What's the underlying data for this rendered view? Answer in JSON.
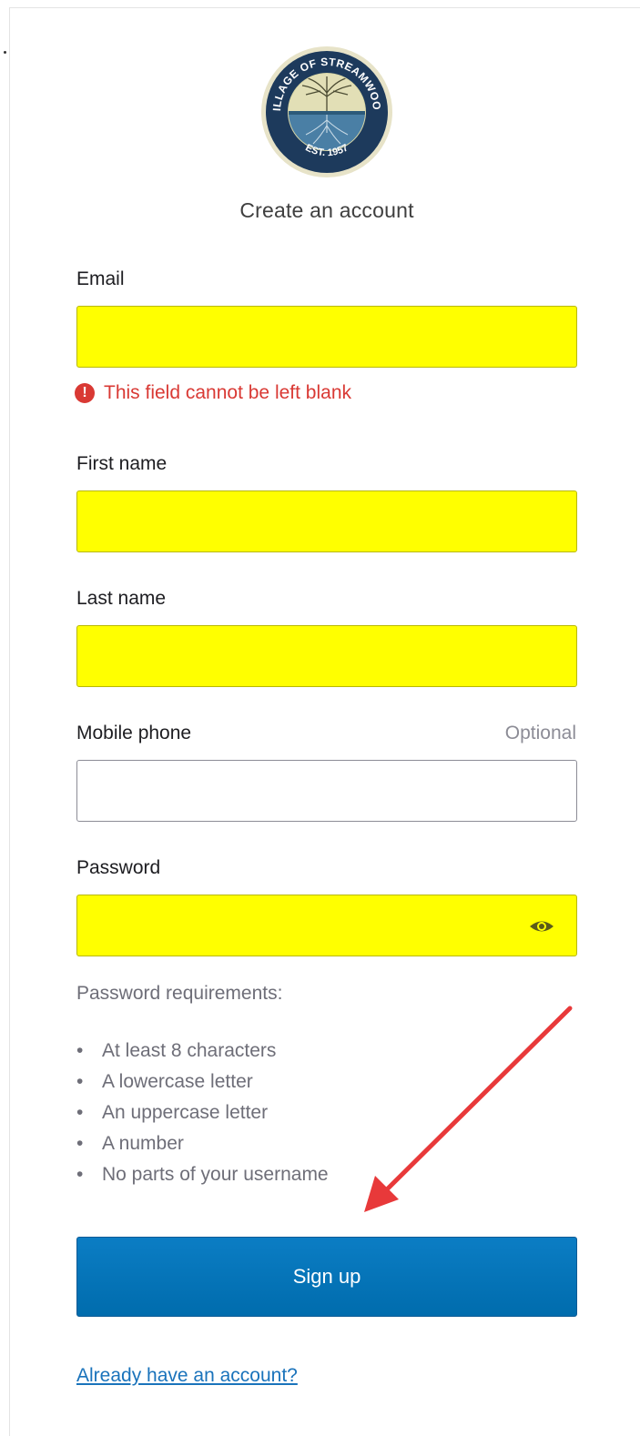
{
  "header": {
    "title": "Create an account",
    "logo": {
      "icon": "village-seal-logo",
      "top_text": "VILLAGE OF STREAMWOOD",
      "bottom_text": "EST. 1957"
    }
  },
  "form": {
    "email": {
      "label": "Email",
      "value": "",
      "error": "This field cannot be left blank"
    },
    "first_name": {
      "label": "First name",
      "value": ""
    },
    "last_name": {
      "label": "Last name",
      "value": ""
    },
    "mobile_phone": {
      "label": "Mobile phone",
      "optional_text": "Optional",
      "value": ""
    },
    "password": {
      "label": "Password",
      "value": "",
      "toggle_icon": "eye-icon"
    }
  },
  "requirements": {
    "heading": "Password requirements:",
    "items": [
      "At least 8 characters",
      "A lowercase letter",
      "An uppercase letter",
      "A number",
      "No parts of your username"
    ]
  },
  "actions": {
    "signup_label": "Sign up",
    "signin_link": "Already have an account?"
  },
  "colors": {
    "highlight": "#ffff00",
    "error": "#d93934",
    "button": "#0074bb",
    "annotation_arrow": "#e8393a"
  }
}
